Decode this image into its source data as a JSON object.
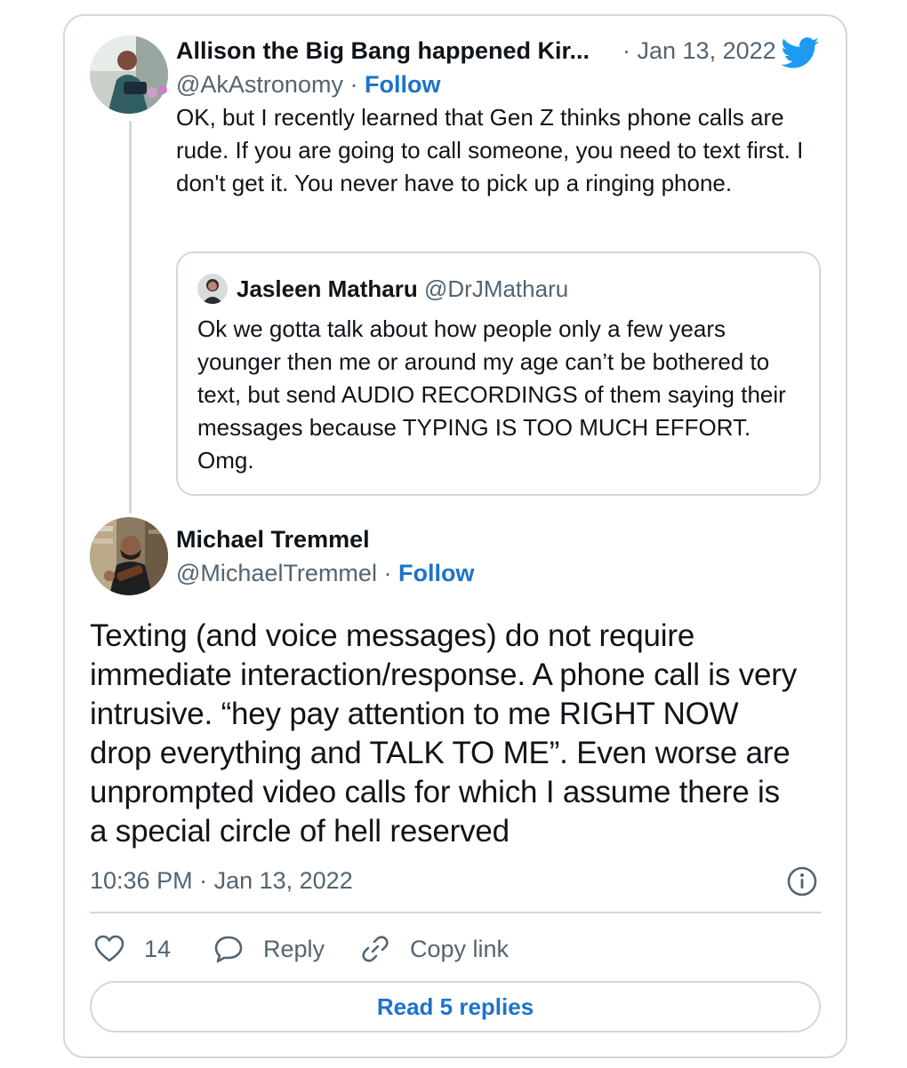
{
  "parent_tweet": {
    "author_name": "Allison the Big Bang happened Kir...",
    "handle": "@AkAstronomy",
    "follow_label": "Follow",
    "date": "Jan 13, 2022",
    "text": "OK, but I recently learned that Gen Z thinks phone calls are rude. If you are going to call someone, you need to text first. I don't get it. You never have to pick up a ringing phone.",
    "quoted": {
      "author_name": "Jasleen Matharu",
      "handle": "@DrJMatharu",
      "text": "Ok we gotta talk about how people only a few years younger then me or around my age can’t be bothered to text, but send AUDIO RECORDINGS of them saying their messages because TYPING IS TOO MUCH EFFORT. Omg."
    }
  },
  "main_tweet": {
    "author_name": "Michael Tremmel",
    "handle": "@MichaelTremmel",
    "follow_label": "Follow",
    "text": "Texting (and voice messages) do not require immediate interaction/response. A phone call is very intrusive. “hey pay attention to me RIGHT NOW drop everything and TALK TO ME”. Even worse are unprompted video calls for which I assume there is a special circle of hell reserved",
    "time": "10:36 PM",
    "date": "Jan 13, 2022"
  },
  "actions": {
    "like_count": "14",
    "reply_label": "Reply",
    "copy_label": "Copy link"
  },
  "read_replies_label": "Read 5 replies",
  "colors": {
    "link_blue": "#1d73c9",
    "twitter_blue": "#1d9bf0",
    "border": "#cfd9de",
    "muted_text": "#536471"
  },
  "icons": [
    "twitter-bird-icon",
    "heart-icon",
    "reply-bubble-icon",
    "link-icon",
    "info-icon"
  ]
}
